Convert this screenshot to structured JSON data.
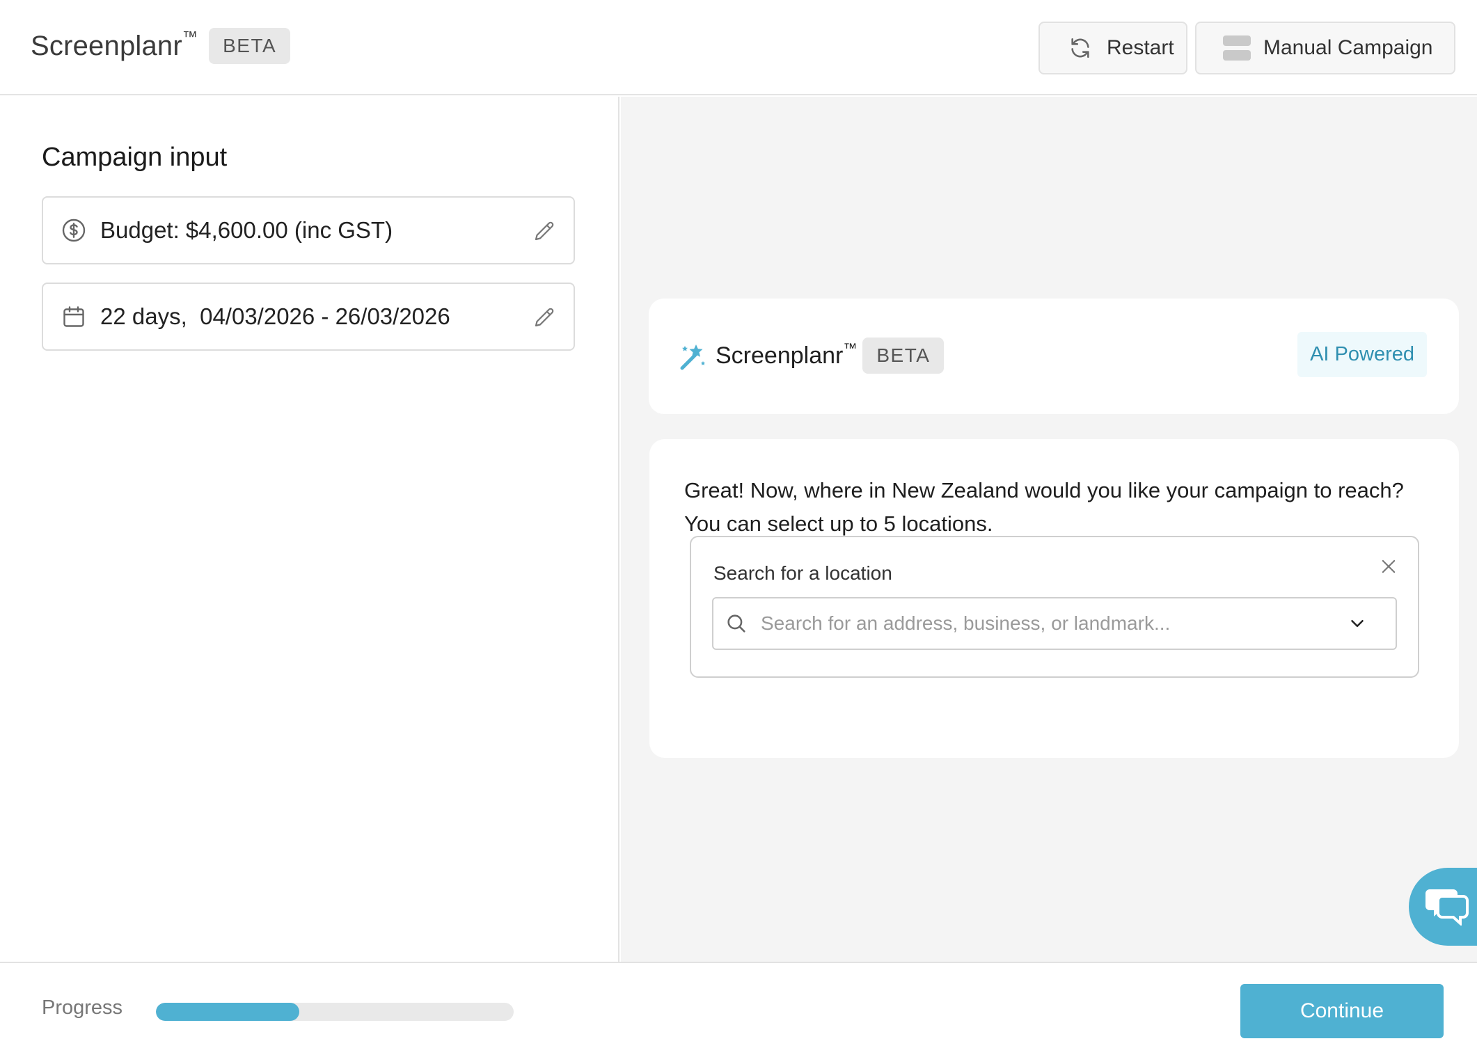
{
  "header": {
    "brand_name": "Screenplanr",
    "brand_tm": "™",
    "beta_label": "BETA",
    "restart_label": "Restart",
    "manual_campaign_label": "Manual Campaign"
  },
  "left_panel": {
    "title": "Campaign input",
    "budget_text": "Budget: $4,600.00 (inc GST)",
    "dates_text": "22 days,  04/03/2026 - 26/03/2026"
  },
  "assistant": {
    "brand_name": "Screenplanr",
    "brand_tm": "™",
    "beta_label": "BETA",
    "ai_badge": "AI Powered",
    "message": "Great! Now, where in New Zealand would you like your campaign to reach? You can select up to 5 locations.",
    "search_label": "Search for a location",
    "search_placeholder": "Search for an address, business, or landmark...",
    "search_value": ""
  },
  "footer": {
    "progress_label": "Progress",
    "progress_fraction": 0.4,
    "continue_label": "Continue"
  },
  "colors": {
    "accent": "#4fb1d2",
    "ai_badge_text": "#2f8fb0",
    "ai_badge_bg": "#eef9fc"
  },
  "icons": {
    "restart": "refresh-icon",
    "manual_campaign": "layout-icon",
    "budget": "dollar-circle-icon",
    "dates": "calendar-icon",
    "edit": "pencil-icon",
    "assistant": "magic-wand-icon",
    "search": "search-icon",
    "close": "close-icon",
    "dropdown": "chevron-down-icon",
    "chat": "chat-bubbles-icon"
  }
}
